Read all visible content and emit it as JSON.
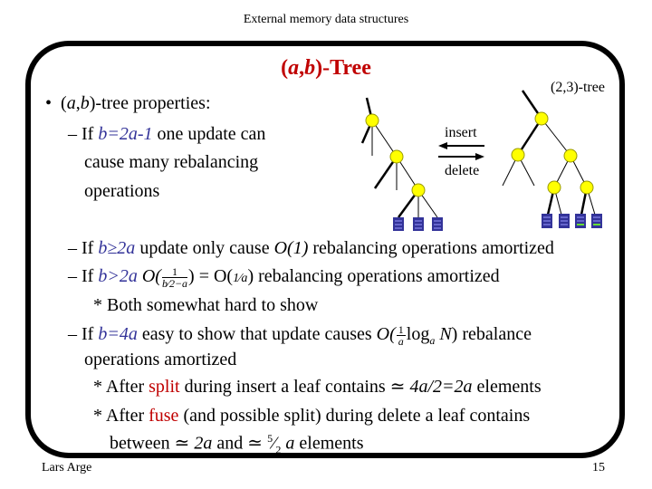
{
  "header": {
    "title": "External memory data structures"
  },
  "slide": {
    "title_prefix": "(",
    "title_a": "a",
    "title_comma": ",",
    "title_b": "b",
    "title_suffix": ")-Tree",
    "bullet": {
      "symbol": "•",
      "text_pre": "(",
      "a": "a",
      "comma": ",",
      "b": "b",
      "text_post": ")-tree properties:"
    },
    "item1": {
      "dash": "–",
      "if": "If",
      "cond": "b=2a-1",
      "rest1": "one update can",
      "line2": "cause many rebalancing",
      "line3": "operations"
    },
    "item2": {
      "dash": "–",
      "if": "If",
      "cond": "b≥2a",
      "rest_pre": "update only cause",
      "o1": "O(1)",
      "rest_post": "rebalancing operations amortized"
    },
    "item3": {
      "dash": "–",
      "if": "If",
      "cond": "b>2a",
      "formula_O": "O(",
      "formula_num": "1",
      "formula_den": "b⁄2−a",
      "formula_eq": ") = O(",
      "formula_frac": "1⁄a",
      "formula_close": ")",
      "rest": "rebalancing operations amortized"
    },
    "item3_note": "* Both somewhat hard to show",
    "item4": {
      "dash": "–",
      "if": "If",
      "cond": "b=4a",
      "rest_pre": "easy to show that update causes",
      "formula_O": "O(",
      "formula_num": "1",
      "formula_den": "a",
      "formula_log": "log",
      "formula_sub": "a",
      "formula_N": "N",
      "formula_close": ")",
      "rest_post": "rebalance",
      "line2": "operations amortized"
    },
    "note1": {
      "star": "*",
      "pre": "After",
      "keyword": "split",
      "post": "during insert a leaf contains",
      "approx": "≃",
      "expr": "4a/2=2a",
      "tail": "elements"
    },
    "note2": {
      "star": "*",
      "pre": "After",
      "keyword": "fuse",
      "post": "(and possible split) during delete a leaf contains"
    },
    "note2_line2": {
      "pre": "between",
      "approx1": "≃",
      "expr1": "2a",
      "and": "and",
      "approx2": "≃",
      "frac_num": "5",
      "frac_den": "2",
      "var": "a",
      "tail": "elements"
    }
  },
  "diagram": {
    "tree_label": "(2,3)-tree",
    "insert_label": "insert",
    "delete_label": "delete",
    "insert_direction": "left",
    "delete_direction": "right",
    "colors": {
      "node_fill": "#ffff00",
      "node_stroke": "#999900",
      "leaf_fill": "#333399",
      "leaf_stripe": "#6666cc",
      "leaf_new_stripe": "#66dd33",
      "edge": "#000000"
    },
    "left_tree_leaves": 3,
    "right_tree_leaves": 4,
    "right_tree_new_leaves": 2
  },
  "footer": {
    "author": "Lars Arge",
    "page": "15"
  }
}
